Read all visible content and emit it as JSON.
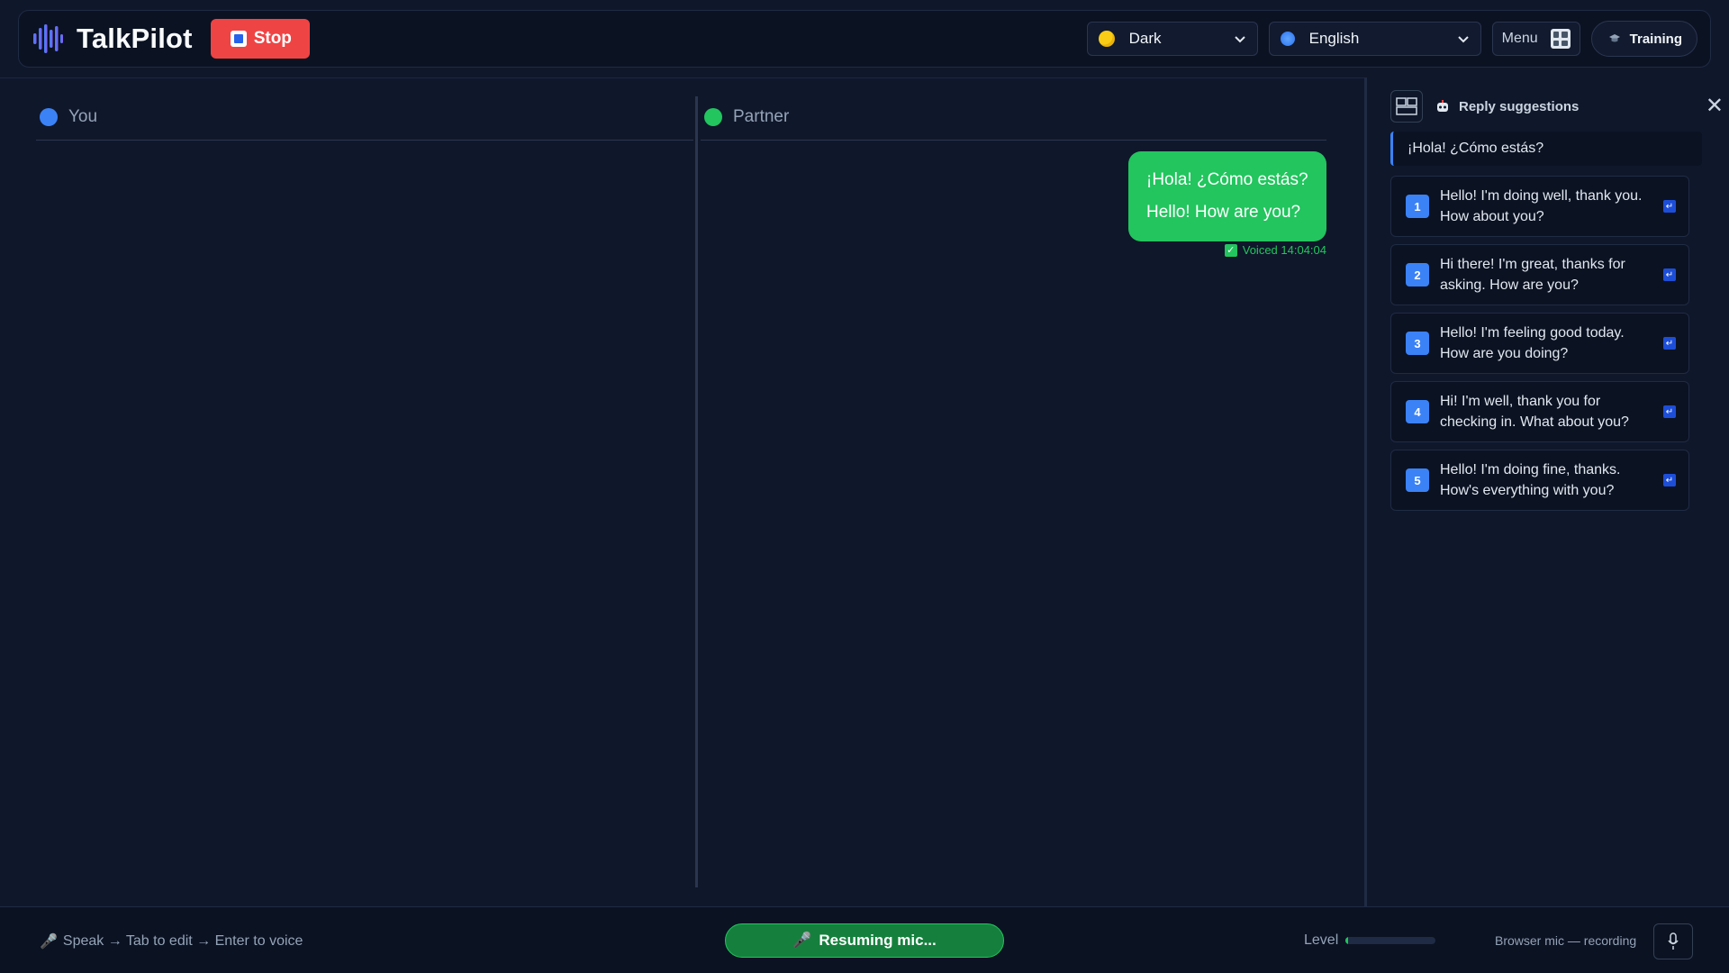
{
  "header": {
    "brand": "TalkPilot",
    "stop_label": "Stop",
    "theme": {
      "value": "Dark",
      "icon": "palette-icon"
    },
    "language": {
      "value": "English",
      "icon": "globe-icon"
    },
    "menu_label": "Menu",
    "training_label": "Training"
  },
  "columns": {
    "you": {
      "title": "You",
      "color": "#3b82f6"
    },
    "partner": {
      "title": "Partner",
      "color": "#22c55e"
    }
  },
  "messages": [
    {
      "speaker": "partner",
      "original": "¡Hola! ¿Cómo estás?",
      "translation": "Hello! How are you?",
      "status": "Voiced 14:04:04"
    }
  ],
  "sidebar": {
    "title": "Reply suggestions",
    "quote": "¡Hola! ¿Cómo estás?",
    "suggestions": [
      {
        "num": "1",
        "text": "Hello! I'm doing well, thank you. How about you?"
      },
      {
        "num": "2",
        "text": "Hi there! I'm great, thanks for asking. How are you?"
      },
      {
        "num": "3",
        "text": "Hello! I'm feeling good today. How are you doing?"
      },
      {
        "num": "4",
        "text": "Hi! I'm well, thank you for checking in. What about you?"
      },
      {
        "num": "5",
        "text": "Hello! I'm doing fine, thanks. How's everything with you?"
      }
    ]
  },
  "footer": {
    "hint": "Speak → Tab to edit → Enter to voice",
    "mic_button": "Resuming mic...",
    "level_label": "Level",
    "level_value": 0.03,
    "mic_status": "Browser mic — recording"
  },
  "colors": {
    "accent": "#3b82f6",
    "stop": "#ef4444",
    "success": "#22c55e"
  }
}
